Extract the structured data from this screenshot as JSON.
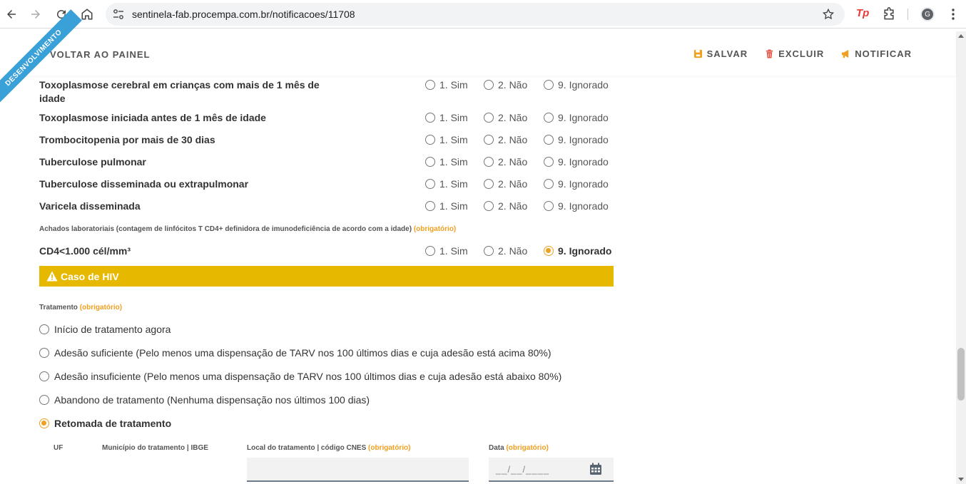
{
  "browser": {
    "url": "sentinela-fab.procempa.com.br/notificacoes/11708",
    "profile_initial": "G",
    "extension_label": "Tp"
  },
  "header": {
    "ribbon": "DESENVOLVIMENTO",
    "back": "VOLTAR AO PAINEL",
    "save": "SALVAR",
    "delete": "EXCLUIR",
    "notify": "NOTIFICAR"
  },
  "options": {
    "sim": "1. Sim",
    "nao": "2. Não",
    "ignorado": "9. Ignorado"
  },
  "questions": [
    {
      "label": "Toxoplasmose cerebral em crianças com mais de 1 mês de idade",
      "selected": null
    },
    {
      "label": "Toxoplasmose iniciada antes de 1 mês de idade",
      "selected": null
    },
    {
      "label": "Trombocitopenia por mais de 30 dias",
      "selected": null
    },
    {
      "label": "Tuberculose pulmonar",
      "selected": null
    },
    {
      "label": "Tuberculose disseminada ou extrapulmonar",
      "selected": null
    },
    {
      "label": "Varicela disseminada",
      "selected": null
    }
  ],
  "lab": {
    "section_label": "Achados laboratoriais (contagem de linfócitos T CD4+ definidora de imunodeficiência de acordo com a idade)",
    "required": "(obrigatório)",
    "question": "CD4<1.000 cél/mm³",
    "selected": "ignorado"
  },
  "hiv_banner": "Caso de HIV",
  "treatment": {
    "label": "Tratamento",
    "required": "(obrigatório)",
    "options": [
      "Início de tratamento agora",
      "Adesão suficiente (Pelo menos uma dispensação de TARV nos 100 últimos dias e cuja adesão está acima 80%)",
      "Adesão insuficiente (Pelo menos uma dispensação de TARV nos 100 últimos dias e cuja adesão está abaixo 80%)",
      "Abandono de tratamento (Nenhuma dispensação nos últimos 100 dias)",
      "Retomada de tratamento"
    ],
    "selected_index": 4
  },
  "fields": {
    "uf": "UF",
    "municipio": "Município do tratamento | IBGE",
    "local": "Local do tratamento | código CNES",
    "local_required": "(obrigatório)",
    "data": "Data",
    "data_required": "(obrigatório)",
    "data_placeholder": "__/__/____",
    "local_value": ""
  },
  "colors": {
    "accent": "#f0a020",
    "banner": "#e6b800",
    "ribbon": "#3aa0d8"
  }
}
